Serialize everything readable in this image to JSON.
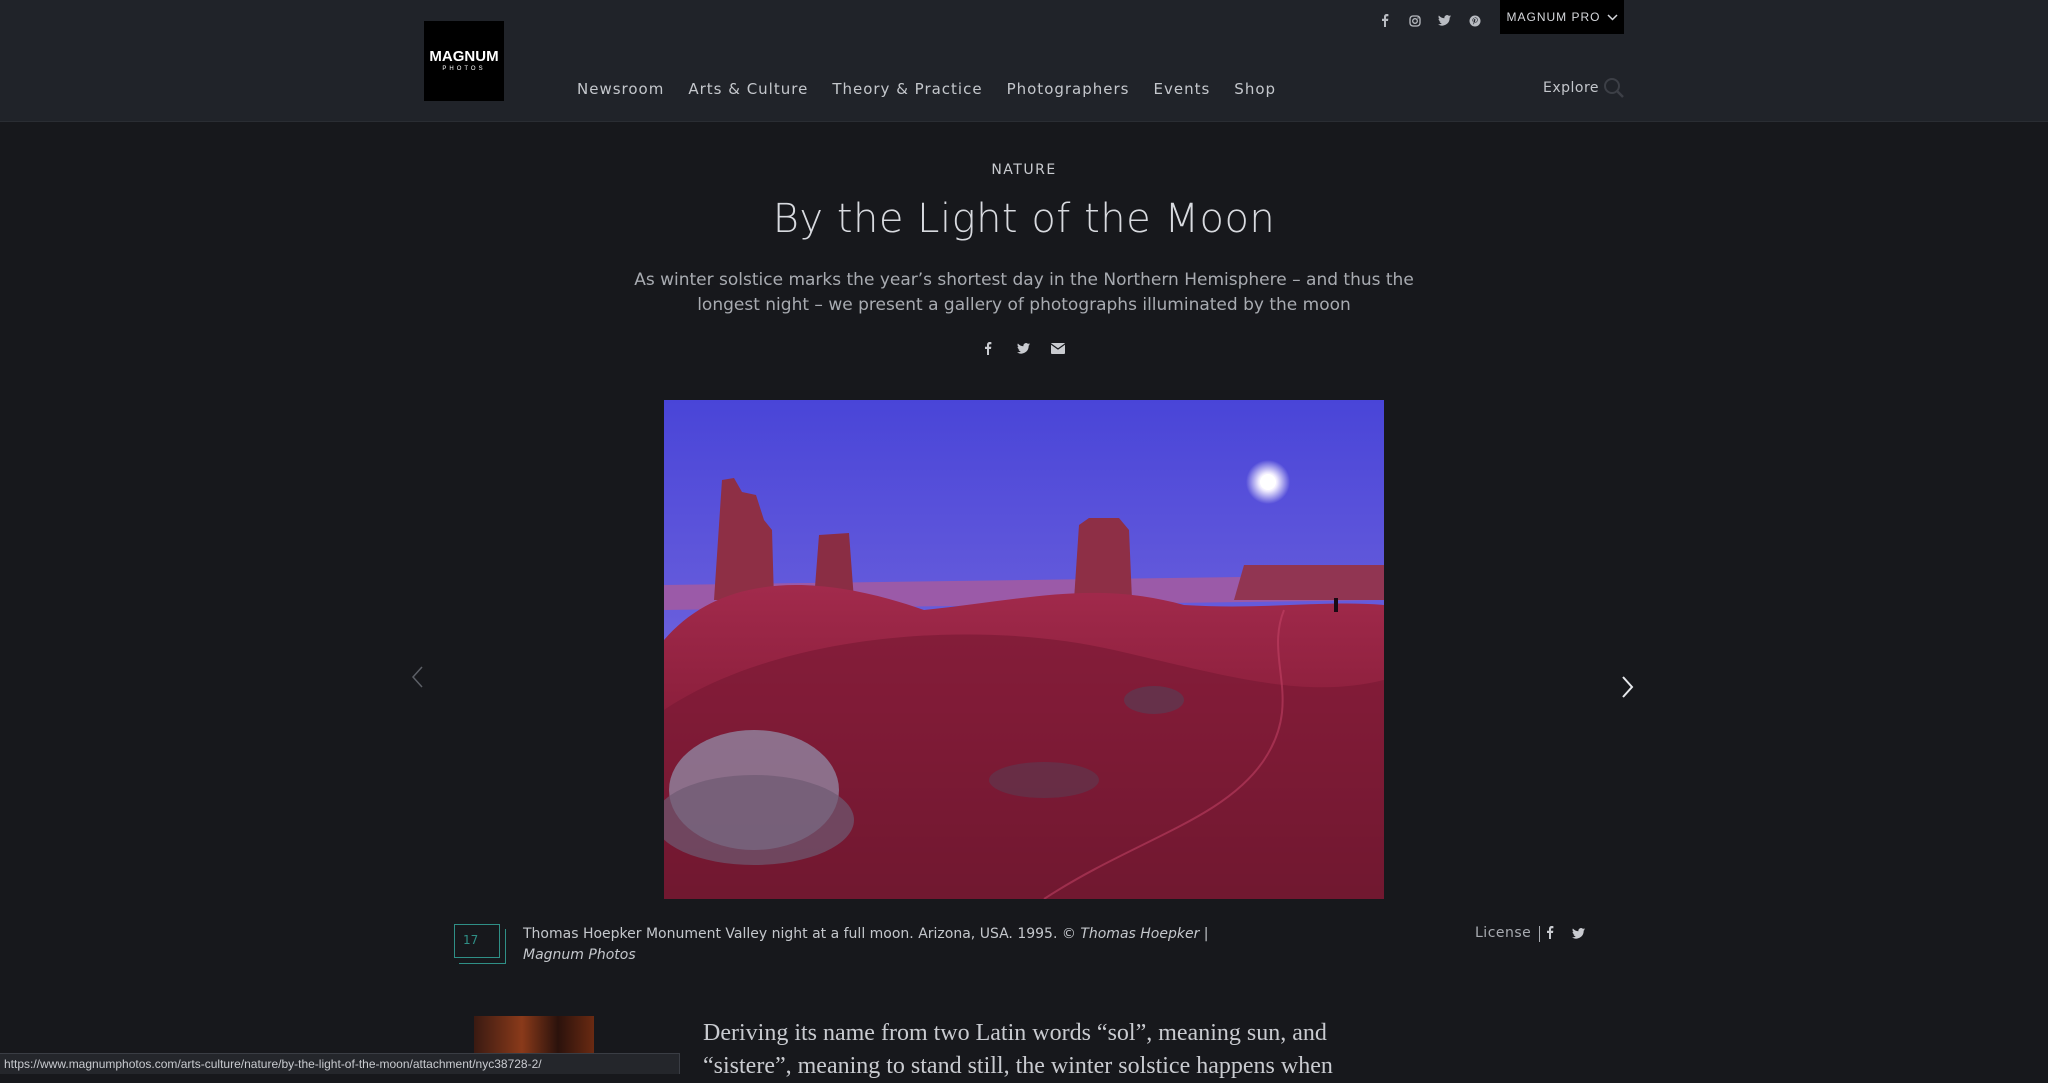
{
  "header": {
    "logo_top": "MAGNUM",
    "logo_bottom": "PHOTOS",
    "pro_label": "MAGNUM PRO",
    "nav": [
      "Newsroom",
      "Arts & Culture",
      "Theory & Practice",
      "Photographers",
      "Events",
      "Shop"
    ],
    "explore_label": "Explore",
    "social_icons": [
      "facebook-icon",
      "instagram-icon",
      "twitter-icon",
      "pinterest-icon"
    ]
  },
  "article": {
    "category": "NATURE",
    "title": "By the Light of the Moon",
    "subtitle": "As winter solstice marks the year’s shortest day in the Northern Hemisphere – and thus the longest night – we present a gallery of photographs illuminated by the moon",
    "share_icons": [
      "facebook-icon",
      "twitter-icon",
      "email-icon"
    ]
  },
  "gallery": {
    "count": "17",
    "caption_main": "Thomas Hoepker Monument Valley night at a full moon. Arizona, USA. 1995. © ",
    "caption_credit": "Thomas Hoepker | Magnum Photos",
    "license_label": "License",
    "colors": {
      "accent": "#2f8f86"
    }
  },
  "body": {
    "intro": "Deriving its name from two Latin words “sol”, meaning sun, and “sistere”, meaning to stand still, the winter solstice happens when"
  },
  "status_bar": {
    "url": "https://www.magnumphotos.com/arts-culture/nature/by-the-light-of-the-moon/attachment/nyc38728-2/"
  }
}
